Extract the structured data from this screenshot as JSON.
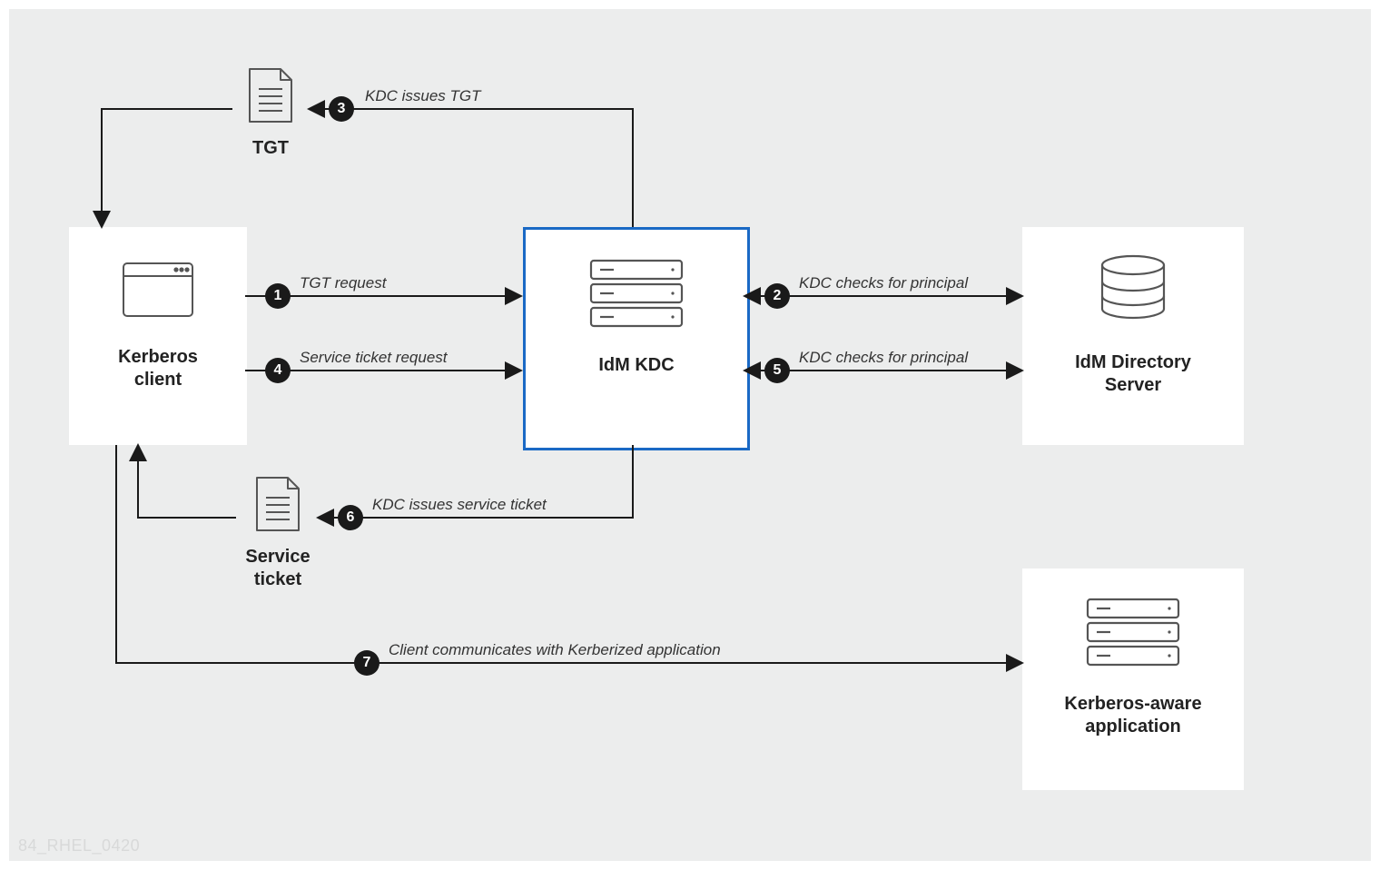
{
  "nodes": {
    "client": {
      "label": "Kerberos\nclient"
    },
    "kdc": {
      "label": "IdM KDC"
    },
    "dir": {
      "label": "IdM Directory\nServer"
    },
    "app": {
      "label": "Kerberos-aware\napplication"
    },
    "tgt": {
      "label": "TGT"
    },
    "svcTkt": {
      "label": "Service\nticket"
    }
  },
  "steps": {
    "s1": {
      "num": "1",
      "text": "TGT request"
    },
    "s2": {
      "num": "2",
      "text": "KDC checks for principal"
    },
    "s3": {
      "num": "3",
      "text": "KDC issues TGT"
    },
    "s4": {
      "num": "4",
      "text": "Service ticket request"
    },
    "s5": {
      "num": "5",
      "text": "KDC checks for principal"
    },
    "s6": {
      "num": "6",
      "text": "KDC issues service ticket"
    },
    "s7": {
      "num": "7",
      "text": "Client communicates with Kerberized application"
    }
  },
  "watermark": "84_RHEL_0420"
}
